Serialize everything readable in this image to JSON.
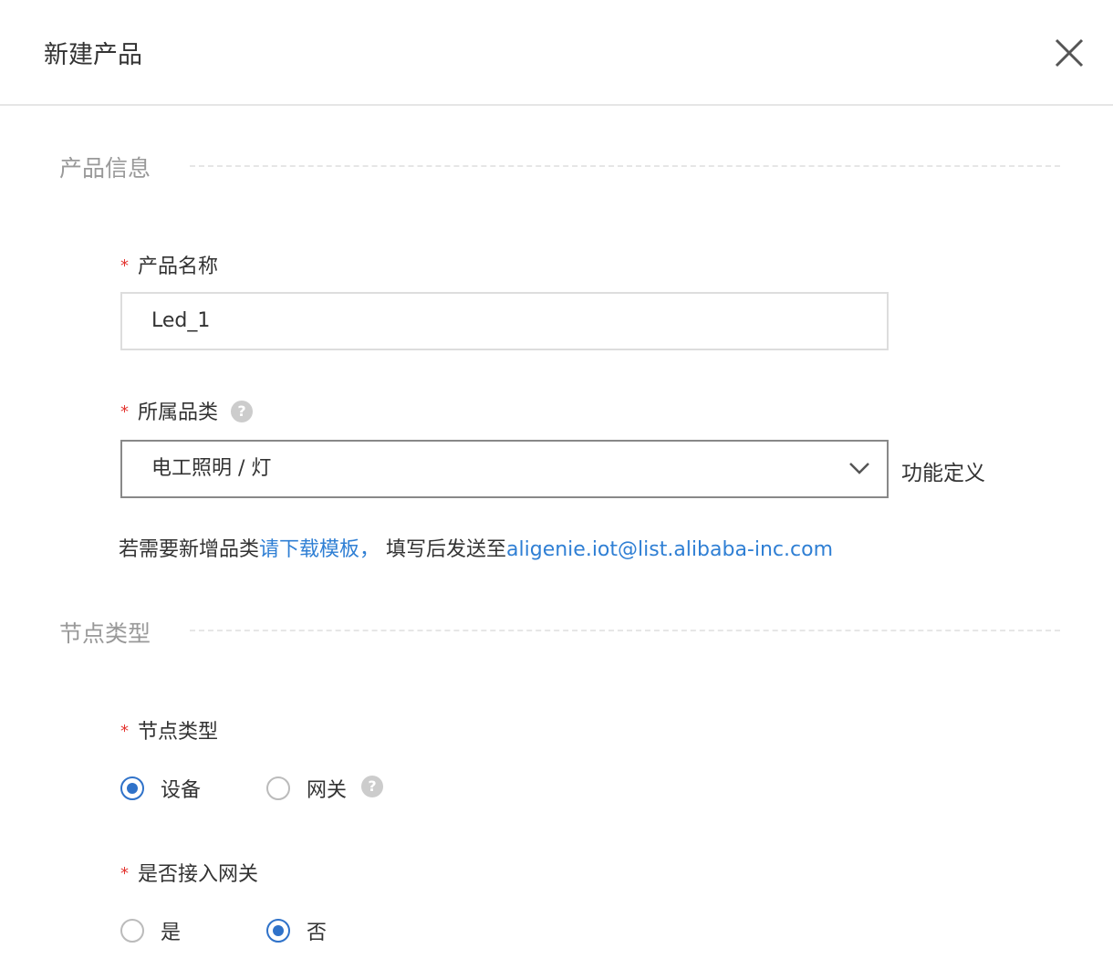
{
  "dialog": {
    "title": "新建产品",
    "close_icon": "close-icon"
  },
  "sections": {
    "product_info": "产品信息",
    "node_type": "节点类型"
  },
  "form": {
    "required_mark": "*",
    "product_name": {
      "label": "产品名称",
      "value": "Led_1"
    },
    "category": {
      "label": "所属品类",
      "help_icon": "question-icon",
      "help_text": "?",
      "selected": "电工照明 / 灯",
      "side_link": "功能定义"
    },
    "hint": {
      "prefix": "若需要新增品类",
      "download_link": "请下载模板，",
      "middle": " 填写后发送至",
      "email_link": "aligenie.iot@list.alibaba-inc.com"
    },
    "node_type": {
      "label": "节点类型",
      "options": [
        {
          "label": "设备",
          "checked": true
        },
        {
          "label": "网关",
          "checked": false
        }
      ]
    },
    "gateway_access": {
      "label": "是否接入网关",
      "options": [
        {
          "label": "是",
          "checked": false
        },
        {
          "label": "否",
          "checked": true
        }
      ]
    }
  },
  "colors": {
    "accent": "#2f72c9",
    "link": "#2f7fd4",
    "required": "#e3342f",
    "section_title": "#999999"
  }
}
